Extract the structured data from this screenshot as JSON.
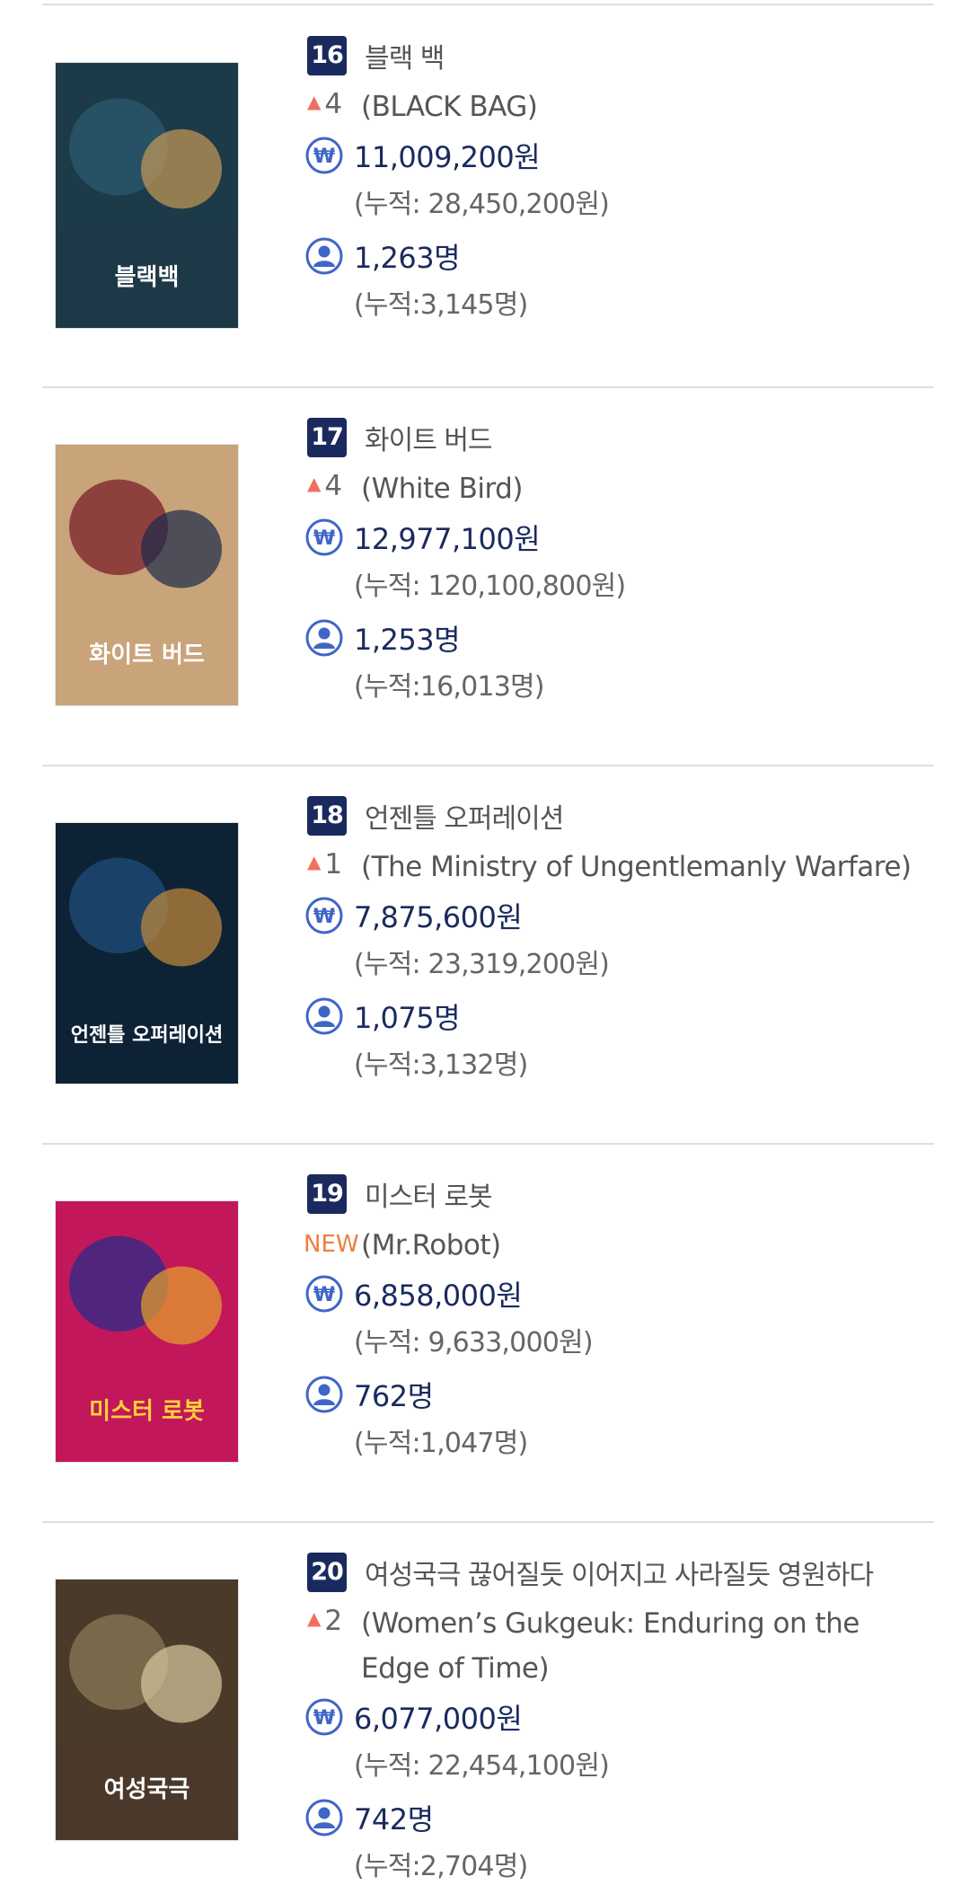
{
  "movies": [
    {
      "rank": "16",
      "title_ko": "블랙 백",
      "change": "4",
      "change_type": "up",
      "title_en": "(BLACK BAG)",
      "revenue": "11,009,200원",
      "revenue_cum": "(누적: 28,450,200원)",
      "audience": "1,263명",
      "audience_cum": "(누적:3,145명)",
      "poster_title": "블랙백",
      "poster_colors": [
        "#2b5a6e",
        "#c79a55",
        "#1d3a48"
      ]
    },
    {
      "rank": "17",
      "title_ko": "화이트 버드",
      "change": "4",
      "change_type": "up",
      "title_en": "(White Bird)",
      "revenue": "12,977,100원",
      "revenue_cum": "(누적: 120,100,800원)",
      "audience": "1,253명",
      "audience_cum": "(누적:16,013명)",
      "poster_title": "화이트 버드",
      "poster_colors": [
        "#7a1f28",
        "#1a2a4a",
        "#c9a37a"
      ]
    },
    {
      "rank": "18",
      "title_ko": "언젠틀 오퍼레이션",
      "change": "1",
      "change_type": "up",
      "title_en": "(The Ministry of Ungentlemanly Warfare)",
      "revenue": "7,875,600원",
      "revenue_cum": "(누적: 23,319,200원)",
      "audience": "1,075명",
      "audience_cum": "(누적:3,132명)",
      "poster_title": "언젠틀 오퍼레이션",
      "poster_colors": [
        "#1f4e7a",
        "#c58a3a",
        "#0e2236"
      ]
    },
    {
      "rank": "19",
      "title_ko": "미스터 로봇",
      "change": "NEW",
      "change_type": "new",
      "title_en": "(Mr.Robot)",
      "revenue": "6,858,000원",
      "revenue_cum": "(누적: 9,633,000원)",
      "audience": "762명",
      "audience_cum": "(누적:1,047명)",
      "poster_title": "미스터 로봇",
      "poster_colors": [
        "#2a2a8a",
        "#e5a32a",
        "#c2185b"
      ]
    },
    {
      "rank": "20",
      "title_ko": "여성국극 끊어질듯 이어지고 사라질듯 영원하다",
      "change": "2",
      "change_type": "up",
      "title_en": "(Women’s Gukgeuk: Enduring on the Edge of Time)",
      "revenue": "6,077,000원",
      "revenue_cum": "(누적: 22,454,100원)",
      "audience": "742명",
      "audience_cum": "(누적:2,704명)",
      "poster_title": "여성국극",
      "poster_colors": [
        "#8a7a55",
        "#d9c9a0",
        "#4a3a2a"
      ]
    }
  ],
  "icons": {
    "revenue": "won-icon",
    "audience": "person-icon",
    "up": "arrow-up-icon"
  },
  "colors": {
    "navy": "#1b2a5e",
    "icon_blue": "#3f66c7",
    "up_arrow": "#f07060",
    "new": "#ef7d3c"
  }
}
